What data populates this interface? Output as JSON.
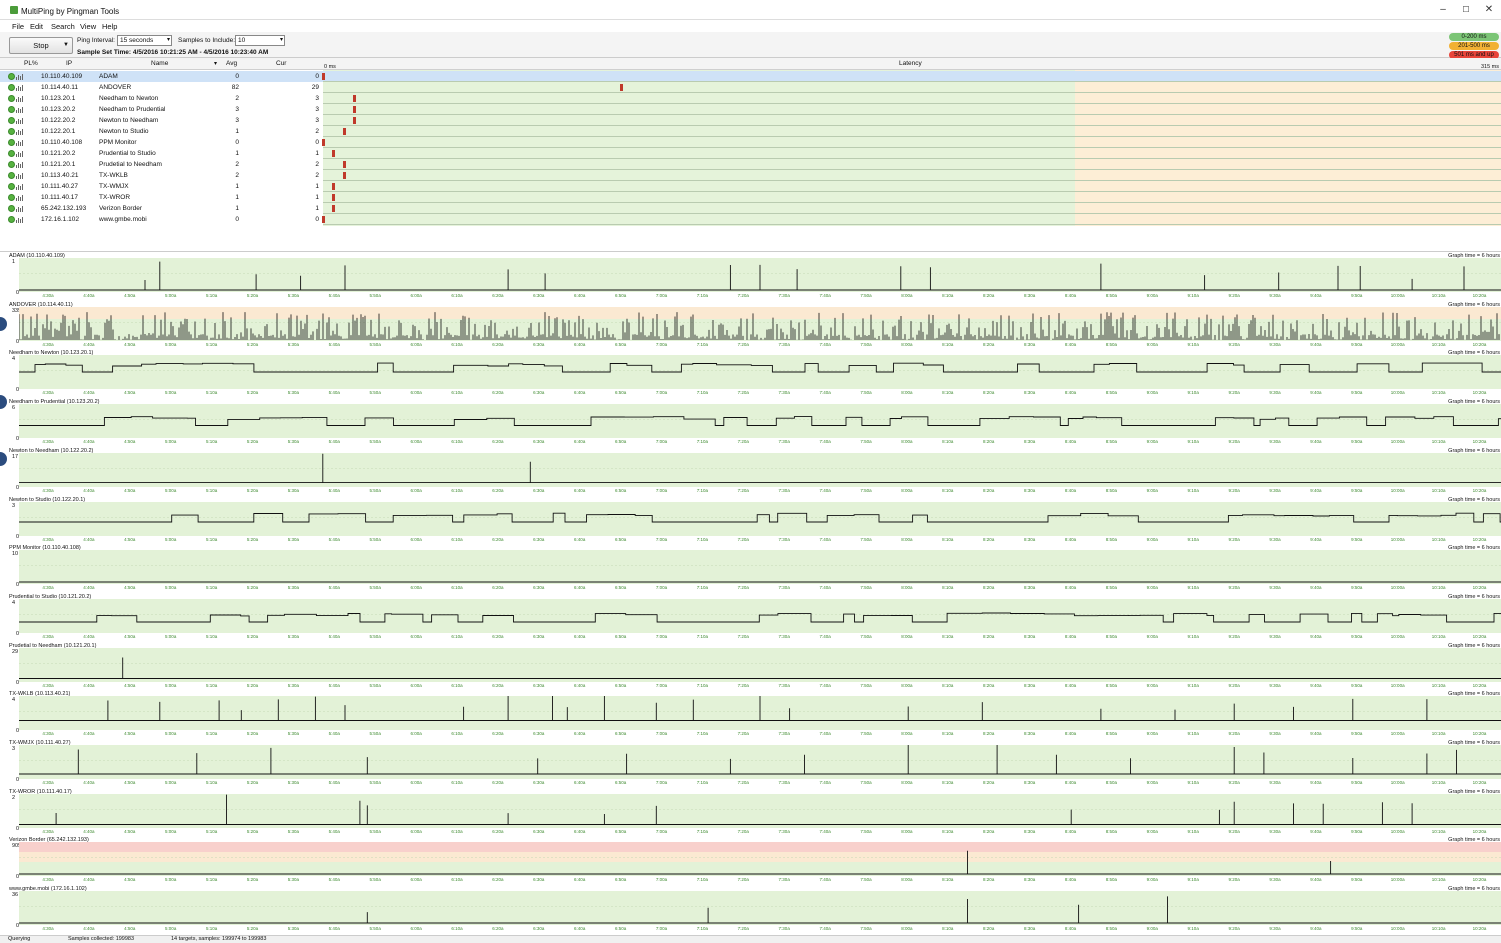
{
  "window": {
    "title": "MultiPing by Pingman Tools",
    "minimize": "–",
    "maximize": "☐",
    "close": "✕",
    "icon": "multiping-app-icon"
  },
  "menu": [
    "File",
    "Edit",
    "Search",
    "View",
    "Help"
  ],
  "toolbar": {
    "stop_label": "Stop",
    "ping_interval_label": "Ping Interval:",
    "ping_interval_value": "15 seconds",
    "samples_label": "Samples to Include:",
    "samples_value": "10",
    "sample_set_time": "Sample Set Time: 4/5/2016 10:21:25 AM - 4/5/2016 10:23:40 AM"
  },
  "legend": [
    {
      "label": "0-200 ms",
      "color": "#7cc576"
    },
    {
      "label": "201-500 ms",
      "color": "#f2b134"
    },
    {
      "label": "501 ms and up",
      "color": "#e8443a"
    }
  ],
  "columns": {
    "pl": "PL%",
    "ip": "IP",
    "name": "Name",
    "avg": "Avg",
    "cur": "Cur",
    "latency": "Latency",
    "lat_start": "0 ms",
    "lat_end": "315 ms"
  },
  "targets": [
    {
      "ip": "10.110.40.109",
      "name": "ADAM",
      "avg": "0",
      "cur": "0",
      "lat": 0
    },
    {
      "ip": "10.114.40.11",
      "name": "ANDOVER",
      "avg": "82",
      "cur": "29",
      "lat": 29
    },
    {
      "ip": "10.123.20.1",
      "name": "Needham to Newton",
      "avg": "2",
      "cur": "3",
      "lat": 3
    },
    {
      "ip": "10.123.20.2",
      "name": "Needham to Prudential",
      "avg": "3",
      "cur": "3",
      "lat": 3
    },
    {
      "ip": "10.122.20.2",
      "name": "Newton to Needham",
      "avg": "3",
      "cur": "3",
      "lat": 3
    },
    {
      "ip": "10.122.20.1",
      "name": "Newton to Studio",
      "avg": "1",
      "cur": "2",
      "lat": 2
    },
    {
      "ip": "10.110.40.108",
      "name": "PPM Monitor",
      "avg": "0",
      "cur": "0",
      "lat": 0
    },
    {
      "ip": "10.121.20.2",
      "name": "Prudential to Studio",
      "avg": "1",
      "cur": "1",
      "lat": 1
    },
    {
      "ip": "10.121.20.1",
      "name": "Prudetial to Needham",
      "avg": "2",
      "cur": "2",
      "lat": 2
    },
    {
      "ip": "10.113.40.21",
      "name": "TX-WKLB",
      "avg": "2",
      "cur": "2",
      "lat": 2
    },
    {
      "ip": "10.111.40.27",
      "name": "TX-WMJX",
      "avg": "1",
      "cur": "1",
      "lat": 1
    },
    {
      "ip": "10.111.40.17",
      "name": "TX-WROR",
      "avg": "1",
      "cur": "1",
      "lat": 1
    },
    {
      "ip": "65.242.132.193",
      "name": "Verizon Border",
      "avg": "1",
      "cur": "1",
      "lat": 1
    },
    {
      "ip": "172.16.1.102",
      "name": "www.gmbe.mobi",
      "avg": "0",
      "cur": "0",
      "lat": 0
    }
  ],
  "graph_time_label": "Graph time = 6 hours",
  "x_ticks": [
    "4:30a",
    "4:40a",
    "4:50a",
    "5:00a",
    "5:10a",
    "5:20a",
    "5:30a",
    "5:40a",
    "5:50a",
    "6:00a",
    "6:10a",
    "6:20a",
    "6:30a",
    "6:40a",
    "6:50a",
    "7:00a",
    "7:10a",
    "7:20a",
    "7:30a",
    "7:40a",
    "7:50a",
    "8:00a",
    "8:10a",
    "8:20a",
    "8:30a",
    "8:40a",
    "8:50a",
    "9:00a",
    "9:10a",
    "9:20a",
    "9:30a",
    "9:40a",
    "9:50a",
    "10:00a",
    "10:10a",
    "10:20a"
  ],
  "graphs": [
    {
      "title": "ADAM (10.110.40.109)",
      "ymax": "1",
      "baseline": 0.0,
      "spikes": [
        0.085,
        0.095,
        0.16,
        0.19,
        0.22,
        0.33,
        0.355,
        0.48,
        0.5,
        0.525,
        0.595,
        0.615,
        0.73,
        0.8,
        0.85,
        0.89,
        0.905,
        0.94,
        0.975
      ]
    },
    {
      "title": "ANDOVER (10.114.40.11)",
      "ymax": "335",
      "baseline": 0.0,
      "dense": true,
      "warn": true
    },
    {
      "title": "Needham to Newton (10.123.20.1)",
      "ymax": "4",
      "baseline": 0.5,
      "square": true
    },
    {
      "title": "Needham to Prudential (10.123.20.2)",
      "ymax": "6",
      "baseline": 0.35,
      "square": true
    },
    {
      "title": "Newton to Needham (10.122.20.2)",
      "ymax": "17",
      "baseline": 0.08,
      "spikes": [
        0.205,
        0.345
      ]
    },
    {
      "title": "Newton to Studio (10.122.20.1)",
      "ymax": "3",
      "baseline": 0.4,
      "square": true
    },
    {
      "title": "PPM Monitor (10.110.40.108)",
      "ymax": "10",
      "baseline": 0.0,
      "spikes": []
    },
    {
      "title": "Prudential to Studio (10.121.20.2)",
      "ymax": "4",
      "baseline": 0.3,
      "square": true
    },
    {
      "title": "Prudetial to Needham (10.121.20.1)",
      "ymax": "29",
      "baseline": 0.05,
      "spikes": [
        0.07
      ]
    },
    {
      "title": "TX-WKLB (10.113.40.21)",
      "ymax": "4",
      "baseline": 0.25,
      "spikes": [
        0.06,
        0.095,
        0.135,
        0.15,
        0.175,
        0.2,
        0.22,
        0.3,
        0.33,
        0.36,
        0.37,
        0.395,
        0.43,
        0.455,
        0.5,
        0.52,
        0.6,
        0.65,
        0.73,
        0.78,
        0.82,
        0.86,
        0.9,
        0.95
      ]
    },
    {
      "title": "TX-WMJX (10.111.40.27)",
      "ymax": "3",
      "baseline": 0.1,
      "spikes": [
        0.04,
        0.12,
        0.17,
        0.235,
        0.35,
        0.41,
        0.48,
        0.53,
        0.6,
        0.66,
        0.7,
        0.75,
        0.82,
        0.84,
        0.9,
        0.95,
        0.97
      ]
    },
    {
      "title": "TX-WROR (10.111.40.17)",
      "ymax": "2",
      "baseline": 0.05,
      "spikes": [
        0.025,
        0.14,
        0.23,
        0.235,
        0.33,
        0.395,
        0.43,
        0.71,
        0.81,
        0.82,
        0.86,
        0.88,
        0.92,
        0.94
      ]
    },
    {
      "title": "Verizon Border (65.242.132.193)",
      "ymax": "905",
      "baseline": 0.0,
      "spikes": [
        0.64,
        0.885
      ],
      "red": true
    },
    {
      "title": "www.gmbe.mobi (172.16.1.102)",
      "ymax": "36",
      "baseline": 0.0,
      "spikes": [
        0.235,
        0.465,
        0.64,
        0.715,
        0.775
      ]
    }
  ],
  "status": {
    "state": "Querying",
    "samples": "Samples collected: 199983",
    "targets": "14 targets, samples: 199974 to 199983"
  }
}
